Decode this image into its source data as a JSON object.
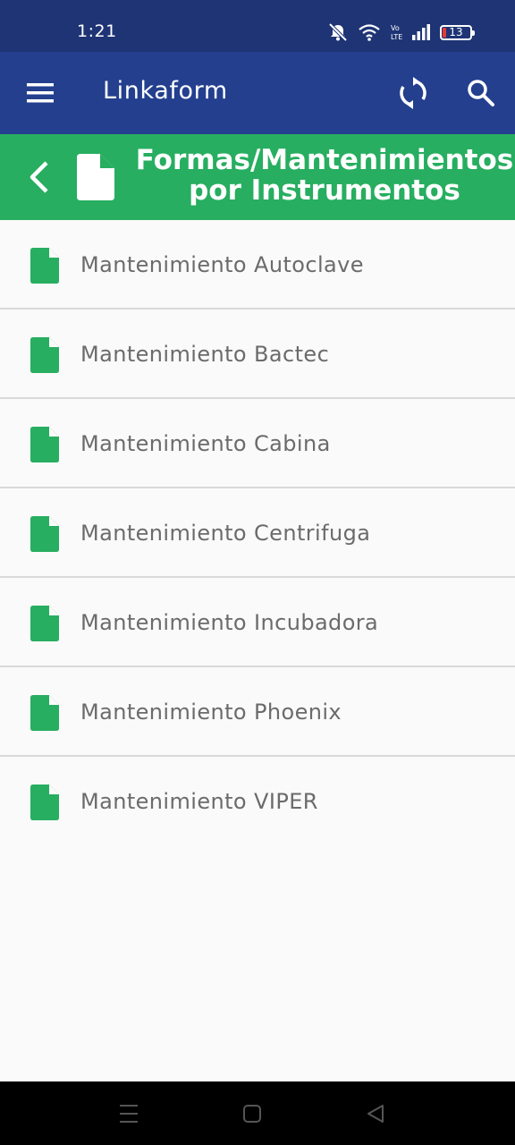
{
  "status_bar": {
    "time": "1:21",
    "battery_level": "13",
    "icons": [
      "mute-bell-icon",
      "wifi-icon",
      "volte-icon",
      "signal-icon",
      "battery-icon"
    ],
    "background": "#1e3475"
  },
  "app_bar": {
    "title": "Linkaform",
    "icons": [
      "menu-icon",
      "sync-icon",
      "search-icon"
    ],
    "background": "#233f8e"
  },
  "section_header": {
    "title_line1": "Formas/Mantenimientos",
    "title_line2": "por Instrumentos",
    "icons": [
      "back-chevron-icon",
      "document-icon"
    ],
    "background": "#27ae60"
  },
  "list": {
    "items": [
      {
        "label": "Mantenimiento Autoclave"
      },
      {
        "label": "Mantenimiento Bactec"
      },
      {
        "label": "Mantenimiento Cabina"
      },
      {
        "label": "Mantenimiento Centrifuga"
      },
      {
        "label": "Mantenimiento Incubadora"
      },
      {
        "label": "Mantenimiento Phoenix"
      },
      {
        "label": "Mantenimiento VIPER"
      }
    ],
    "icon": "document-icon",
    "icon_color": "#27ae60"
  },
  "nav_bar": {
    "icons": [
      "recents-icon",
      "home-icon",
      "back-triangle-icon"
    ]
  }
}
